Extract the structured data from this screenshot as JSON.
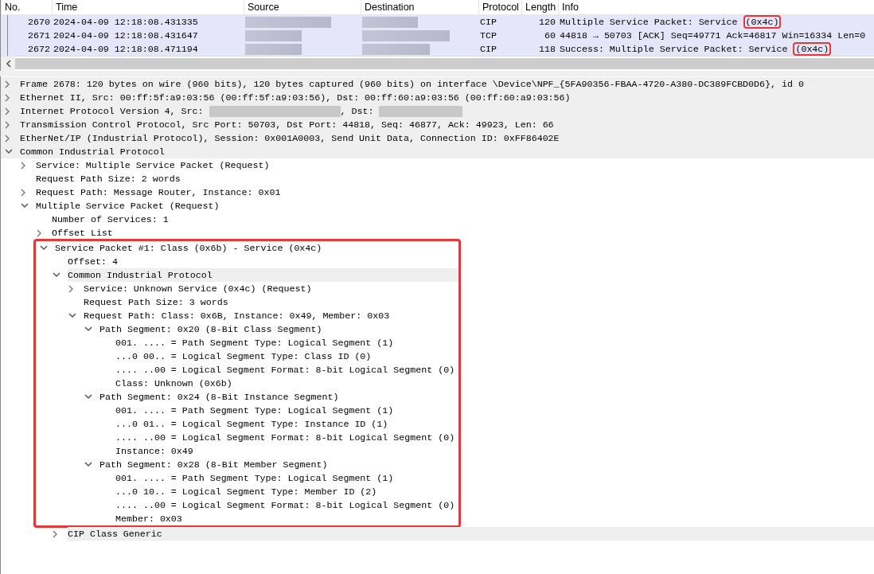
{
  "packet_list": {
    "columns": [
      "No.",
      "Time",
      "Source",
      "Destination",
      "Protocol",
      "Length",
      "Info"
    ],
    "rows": [
      {
        "no": "2670",
        "time": "2024-04-09 12:18:08.431335",
        "protocol": "CIP",
        "length": "120",
        "info": "Multiple Service Packet: Service ",
        "info_highlight": "(0x4c)"
      },
      {
        "no": "2671",
        "time": "2024-04-09 12:18:08.431647",
        "protocol": "TCP",
        "length": "60",
        "info": "44818 → 50703 [ACK] Seq=49771 Ack=46817 Win=16334 Len=0"
      },
      {
        "no": "2672",
        "time": "2024-04-09 12:18:08.471194",
        "protocol": "CIP",
        "length": "118",
        "info": "Success: Multiple Service Packet: Service ",
        "info_highlight": "(0x4c)"
      }
    ]
  },
  "details": [
    {
      "kind": "protocol",
      "highlighted": false,
      "expanded": false,
      "segments": [
        {
          "kind": "text",
          "text": "Frame 2678: 120 bytes on wire (960 bits), 120 bytes captured (960 bits) on interface \\Device\\NPF_{5FA90356-FBAA-4720-A380-DC389FCBD0D6}, id 0"
        }
      ]
    },
    {
      "kind": "protocol",
      "highlighted": false,
      "expanded": false,
      "segments": [
        {
          "kind": "text",
          "text": "Ethernet II, Src: 00:ff:5f:a9:03:56 (00:ff:5f:a9:03:56), Dst: 00:ff:60:a9:03:56 (00:ff:60:a9:03:56)"
        }
      ]
    },
    {
      "kind": "protocol",
      "highlighted": false,
      "expanded": false,
      "segments": [
        {
          "kind": "text",
          "text": "Internet Protocol Version 4, Src: "
        },
        {
          "kind": "redacted"
        },
        {
          "kind": "text",
          "text": ", Dst: "
        },
        {
          "kind": "redacted"
        }
      ]
    },
    {
      "kind": "protocol",
      "highlighted": false,
      "expanded": false,
      "segments": [
        {
          "kind": "text",
          "text": "Transmission Control Protocol, Src Port: 50703, Dst Port: 44818, Seq: 46877, Ack: 49923, Len: 66"
        }
      ]
    },
    {
      "kind": "protocol",
      "highlighted": false,
      "expanded": false,
      "segments": [
        {
          "kind": "text",
          "text": "EtherNet/IP (Industrial Protocol), Session: 0x001A0003, Send Unit Data, Connection ID: 0xFF86402E"
        }
      ]
    },
    {
      "kind": "protocol",
      "highlighted": false,
      "expanded": true,
      "segments": [
        {
          "kind": "text",
          "text": "Common Industrial Protocol"
        }
      ],
      "children": [
        {
          "kind": "field",
          "highlighted": false,
          "expanded": false,
          "segments": [
            {
              "kind": "text",
              "text": "Service: Multiple Service Packet (Request)"
            }
          ]
        },
        {
          "kind": "field",
          "highlighted": false,
          "segments": [
            {
              "kind": "text",
              "text": "Request Path Size: 2 words"
            }
          ]
        },
        {
          "kind": "field",
          "highlighted": false,
          "expanded": false,
          "segments": [
            {
              "kind": "text",
              "text": "Request Path: Message Router, Instance: 0x01"
            }
          ]
        },
        {
          "kind": "field",
          "highlighted": false,
          "expanded": true,
          "segments": [
            {
              "kind": "text",
              "text": "Multiple Service Packet (Request)"
            }
          ],
          "children": [
            {
              "kind": "field",
              "highlighted": false,
              "segments": [
                {
                  "kind": "text",
                  "text": "Number of Services: 1"
                }
              ]
            },
            {
              "kind": "field",
              "highlighted": false,
              "expanded": false,
              "segments": [
                {
                  "kind": "text",
                  "text": "Offset List"
                }
              ]
            },
            {
              "kind": "field",
              "highlighted": true,
              "expanded": true,
              "segments": [
                {
                  "kind": "text",
                  "text": "Service Packet #1: Class (0x6b) - Service (0x4c)"
                }
              ],
              "children": [
                {
                  "kind": "field",
                  "highlighted": true,
                  "segments": [
                    {
                      "kind": "text",
                      "text": "Offset: 4"
                    }
                  ]
                },
                {
                  "kind": "protocol",
                  "highlighted": true,
                  "expanded": true,
                  "segments": [
                    {
                      "kind": "text",
                      "text": "Common Industrial Protocol"
                    }
                  ],
                  "children": [
                    {
                      "kind": "field",
                      "highlighted": true,
                      "expanded": false,
                      "segments": [
                        {
                          "kind": "text",
                          "text": "Service: Unknown Service (0x4c) (Request)"
                        }
                      ]
                    },
                    {
                      "kind": "field",
                      "highlighted": true,
                      "segments": [
                        {
                          "kind": "text",
                          "text": "Request Path Size: 3 words"
                        }
                      ]
                    },
                    {
                      "kind": "field",
                      "highlighted": true,
                      "expanded": true,
                      "segments": [
                        {
                          "kind": "text",
                          "text": "Request Path: Class: 0x6B, Instance: 0x49, Member: 0x03"
                        }
                      ],
                      "children": [
                        {
                          "kind": "field",
                          "highlighted": true,
                          "expanded": true,
                          "segments": [
                            {
                              "kind": "text",
                              "text": "Path Segment: 0x20 (8-Bit Class Segment)"
                            }
                          ],
                          "children": [
                            {
                              "kind": "field",
                              "highlighted": true,
                              "segments": [
                                {
                                  "kind": "text",
                                  "text": "001. .... = Path Segment Type: Logical Segment (1)"
                                }
                              ]
                            },
                            {
                              "kind": "field",
                              "highlighted": true,
                              "segments": [
                                {
                                  "kind": "text",
                                  "text": "...0 00.. = Logical Segment Type: Class ID (0)"
                                }
                              ]
                            },
                            {
                              "kind": "field",
                              "highlighted": true,
                              "segments": [
                                {
                                  "kind": "text",
                                  "text": ".... ..00 = Logical Segment Format: 8-bit Logical Segment (0)"
                                }
                              ]
                            },
                            {
                              "kind": "field",
                              "highlighted": true,
                              "segments": [
                                {
                                  "kind": "text",
                                  "text": "Class: Unknown (0x6b)"
                                }
                              ]
                            }
                          ]
                        },
                        {
                          "kind": "field",
                          "highlighted": true,
                          "expanded": true,
                          "segments": [
                            {
                              "kind": "text",
                              "text": "Path Segment: 0x24 (8-Bit Instance Segment)"
                            }
                          ],
                          "children": [
                            {
                              "kind": "field",
                              "highlighted": true,
                              "segments": [
                                {
                                  "kind": "text",
                                  "text": "001. .... = Path Segment Type: Logical Segment (1)"
                                }
                              ]
                            },
                            {
                              "kind": "field",
                              "highlighted": true,
                              "segments": [
                                {
                                  "kind": "text",
                                  "text": "...0 01.. = Logical Segment Type: Instance ID (1)"
                                }
                              ]
                            },
                            {
                              "kind": "field",
                              "highlighted": true,
                              "segments": [
                                {
                                  "kind": "text",
                                  "text": ".... ..00 = Logical Segment Format: 8-bit Logical Segment (0)"
                                }
                              ]
                            },
                            {
                              "kind": "field",
                              "highlighted": true,
                              "segments": [
                                {
                                  "kind": "text",
                                  "text": "Instance: 0x49"
                                }
                              ]
                            }
                          ]
                        },
                        {
                          "kind": "field",
                          "highlighted": true,
                          "expanded": true,
                          "segments": [
                            {
                              "kind": "text",
                              "text": "Path Segment: 0x28 (8-Bit Member Segment)"
                            }
                          ],
                          "children": [
                            {
                              "kind": "field",
                              "highlighted": true,
                              "segments": [
                                {
                                  "kind": "text",
                                  "text": "001. .... = Path Segment Type: Logical Segment (1)"
                                }
                              ]
                            },
                            {
                              "kind": "field",
                              "highlighted": true,
                              "segments": [
                                {
                                  "kind": "text",
                                  "text": "...0 10.. = Logical Segment Type: Member ID (2)"
                                }
                              ]
                            },
                            {
                              "kind": "field",
                              "highlighted": true,
                              "segments": [
                                {
                                  "kind": "text",
                                  "text": ".... ..00 = Logical Segment Format: 8-bit Logical Segment (0)"
                                }
                              ]
                            },
                            {
                              "kind": "field",
                              "highlighted": true,
                              "segments": [
                                {
                                  "kind": "text",
                                  "text": "Member: 0x03"
                                }
                              ]
                            }
                          ]
                        }
                      ]
                    }
                  ]
                },
                {
                  "kind": "protocol",
                  "highlighted": false,
                  "expanded": false,
                  "segments": [
                    {
                      "kind": "text",
                      "text": "CIP Class Generic"
                    }
                  ]
                }
              ]
            }
          ]
        }
      ]
    }
  ]
}
